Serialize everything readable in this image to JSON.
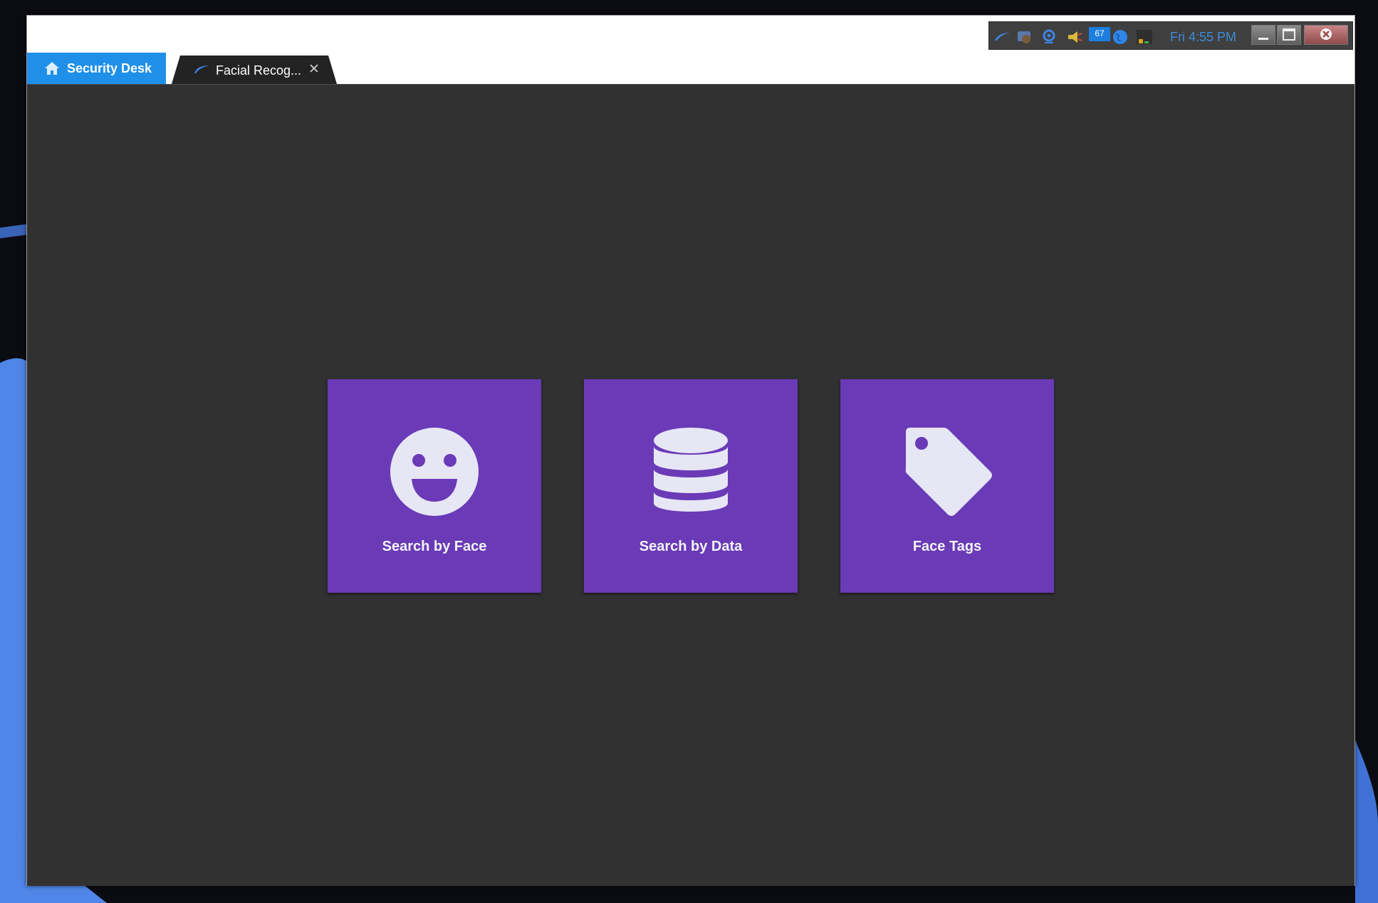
{
  "tabs": {
    "home": {
      "label": "Security Desk"
    },
    "app": {
      "label": "Facial Recog..."
    }
  },
  "tray": {
    "badge_count": "67",
    "clock": "Fri 4:55 PM"
  },
  "tiles": [
    {
      "label": "Search by Face",
      "icon": "smiley-face-icon"
    },
    {
      "label": "Search by Data",
      "icon": "database-icon"
    },
    {
      "label": "Face Tags",
      "icon": "tag-icon"
    }
  ],
  "colors": {
    "tab_accent": "#1e90ea",
    "tile_background": "#6a3ab7",
    "content_background": "#313131",
    "icon_color": "#e6e6f5",
    "clock_color": "#3f8ad8"
  }
}
